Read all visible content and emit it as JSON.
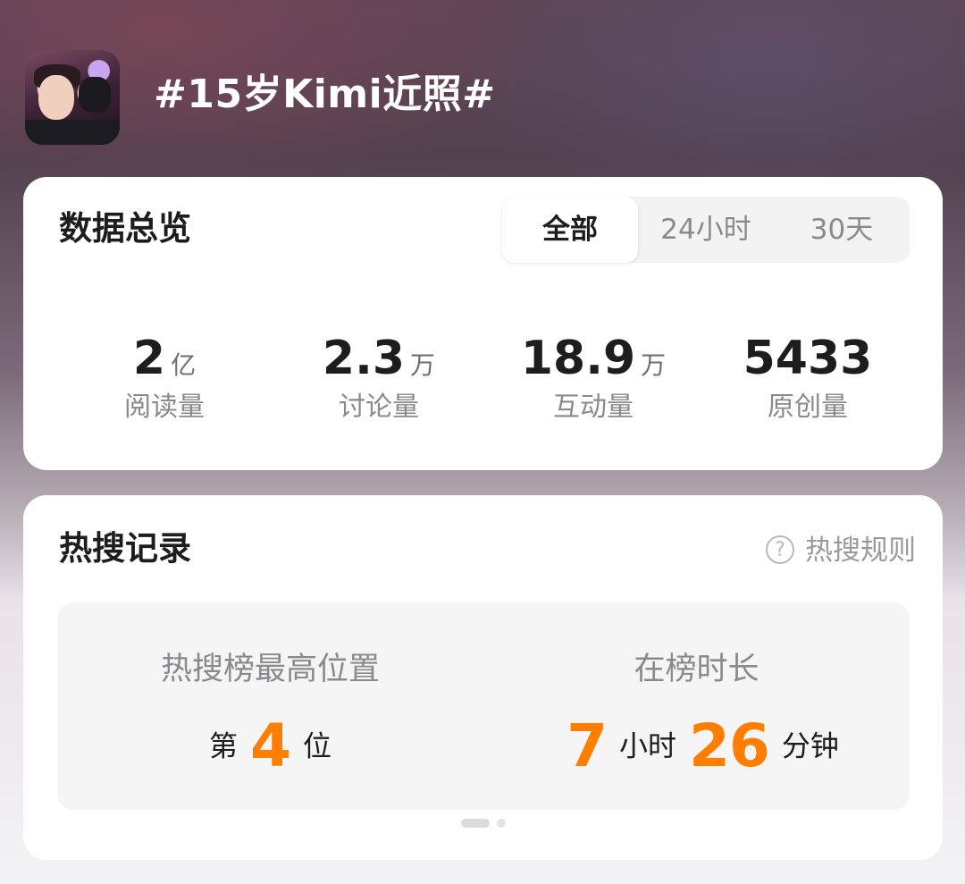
{
  "header": {
    "avatar_desc": "topic-avatar",
    "title": "#15岁Kimi近照#"
  },
  "overview": {
    "title": "数据总览",
    "tabs": [
      {
        "label": "全部",
        "active": true
      },
      {
        "label": "24小时",
        "active": false
      },
      {
        "label": "30天",
        "active": false
      }
    ],
    "stats": [
      {
        "value": "2",
        "unit": "亿",
        "label": "阅读量"
      },
      {
        "value": "2.3",
        "unit": "万",
        "label": "讨论量"
      },
      {
        "value": "18.9",
        "unit": "万",
        "label": "互动量"
      },
      {
        "value": "5433",
        "unit": "",
        "label": "原创量"
      }
    ]
  },
  "hot_search": {
    "title": "热搜记录",
    "rules_label": "热搜规则",
    "rules_icon": "question-circle-icon",
    "peak": {
      "label": "热搜榜最高位置",
      "prefix": "第",
      "rank": "4",
      "suffix": "位"
    },
    "duration": {
      "label": "在榜时长",
      "hours": "7",
      "hours_unit": "小时",
      "minutes": "26",
      "minutes_unit": "分钟"
    },
    "pager": {
      "pages": 2,
      "current": 1
    }
  },
  "colors": {
    "accent": "#ff7e00",
    "text_primary": "#1d1d1f",
    "text_secondary": "#8a8a8e",
    "card_bg": "#ffffff"
  }
}
